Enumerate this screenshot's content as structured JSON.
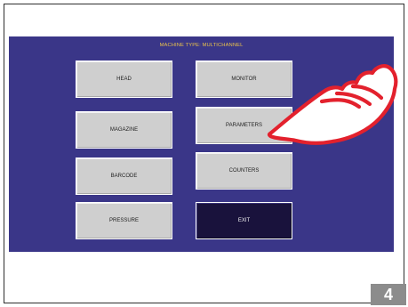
{
  "title": "MACHINE TYPE: MULTICHANNEL",
  "buttons": {
    "head": "HEAD",
    "monitor": "MONITOR",
    "magazine": "MAGAZINE",
    "parameters": "PARAMETERS",
    "barcode": "BARCODE",
    "counters": "COUNTERS",
    "pressure": "PRESSURE",
    "exit": "EXIT"
  },
  "page_number": "4",
  "colors": {
    "screen_background": "#3a3688",
    "title_text": "#e9c24b",
    "button_background": "#cfcfcf",
    "exit_background": "#19123c",
    "hand_outline": "#e3212d"
  },
  "icons": {
    "pointer": "pointing-hand-icon"
  }
}
